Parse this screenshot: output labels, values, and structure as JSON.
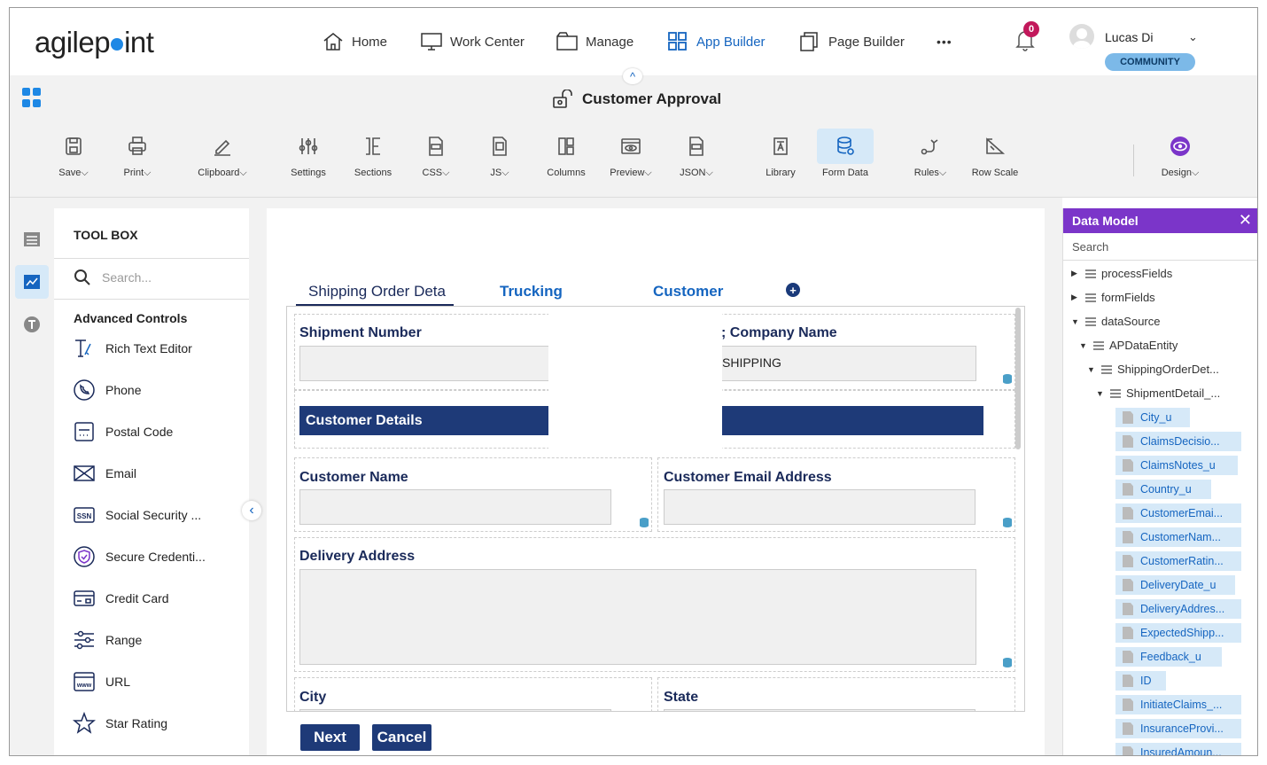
{
  "brand": {
    "logo_text": "agilepint"
  },
  "nav": {
    "items": [
      {
        "label": "Home",
        "icon": "home-icon"
      },
      {
        "label": "Work Center",
        "icon": "monitor-icon"
      },
      {
        "label": "Manage",
        "icon": "folder-icon"
      },
      {
        "label": "App Builder",
        "icon": "grid-icon"
      },
      {
        "label": "Page Builder",
        "icon": "pages-icon"
      }
    ],
    "more": "•••",
    "notifications": "0",
    "user_name": "Lucas Di",
    "user_badge": "COMMUNITY"
  },
  "app": {
    "title": "Customer Approval"
  },
  "ribbon": {
    "items": [
      {
        "label": "Save",
        "has_dropdown": true
      },
      {
        "label": "Print",
        "has_dropdown": true
      },
      {
        "label": "Clipboard",
        "has_dropdown": true
      },
      {
        "label": "Settings"
      },
      {
        "label": "Sections"
      },
      {
        "label": "CSS",
        "has_dropdown": true
      },
      {
        "label": "JS",
        "has_dropdown": true
      },
      {
        "label": "Columns"
      },
      {
        "label": "Preview",
        "has_dropdown": true
      },
      {
        "label": "JSON",
        "has_dropdown": true
      },
      {
        "label": "Library"
      },
      {
        "label": "Form Data",
        "selected": true
      },
      {
        "label": "Rules",
        "has_dropdown": true
      },
      {
        "label": "Row Scale"
      },
      {
        "label": "Design",
        "has_dropdown": true
      }
    ]
  },
  "toolbox": {
    "title": "TOOL BOX",
    "search_placeholder": "Search...",
    "group": "Advanced Controls",
    "items": [
      {
        "label": "Rich Text Editor"
      },
      {
        "label": "Phone"
      },
      {
        "label": "Postal Code"
      },
      {
        "label": "Email"
      },
      {
        "label": "Social Security ..."
      },
      {
        "label": "Secure Credenti..."
      },
      {
        "label": "Credit Card"
      },
      {
        "label": "Range"
      },
      {
        "label": "URL"
      },
      {
        "label": "Star Rating"
      }
    ]
  },
  "form": {
    "tabs": [
      {
        "label": "Shipping Order Deta"
      },
      {
        "label": "Trucking"
      },
      {
        "label": "Customer"
      }
    ],
    "fields": {
      "shipment_number": "Shipment Number",
      "company_name": "; Company Name",
      "company_value": "SHIPPING",
      "customer_details": "Customer Details",
      "customer_name": "Customer Name",
      "customer_email": "Customer Email Address",
      "delivery_address": "Delivery Address",
      "city": "City",
      "state": "State"
    },
    "buttons": {
      "next": "Next",
      "cancel": "Cancel"
    }
  },
  "data_model": {
    "title": "Data Model",
    "search": "Search",
    "close": "✕",
    "tree": [
      {
        "label": "processFields",
        "level": 0,
        "expanded": false
      },
      {
        "label": "formFields",
        "level": 0,
        "expanded": false
      },
      {
        "label": "dataSource",
        "level": 0,
        "expanded": true
      },
      {
        "label": "APDataEntity",
        "level": 1,
        "expanded": true
      },
      {
        "label": "ShippingOrderDet...",
        "level": 2,
        "expanded": true
      },
      {
        "label": "ShipmentDetail_...",
        "level": 3,
        "expanded": true
      }
    ],
    "leaves": [
      "City_u",
      "ClaimsDecisio...",
      "ClaimsNotes_u",
      "Country_u",
      "CustomerEmai...",
      "CustomerNam...",
      "CustomerRatin...",
      "DeliveryDate_u",
      "DeliveryAddres...",
      "ExpectedShipp...",
      "Feedback_u",
      "ID",
      "InitiateClaims_...",
      "InsuranceProvi...",
      "InsuredAmoun..."
    ]
  },
  "colors": {
    "accent": "#1565c0",
    "navy": "#1e3a78",
    "purple": "#7b35c9",
    "selected_bg": "#d6e9f8"
  }
}
